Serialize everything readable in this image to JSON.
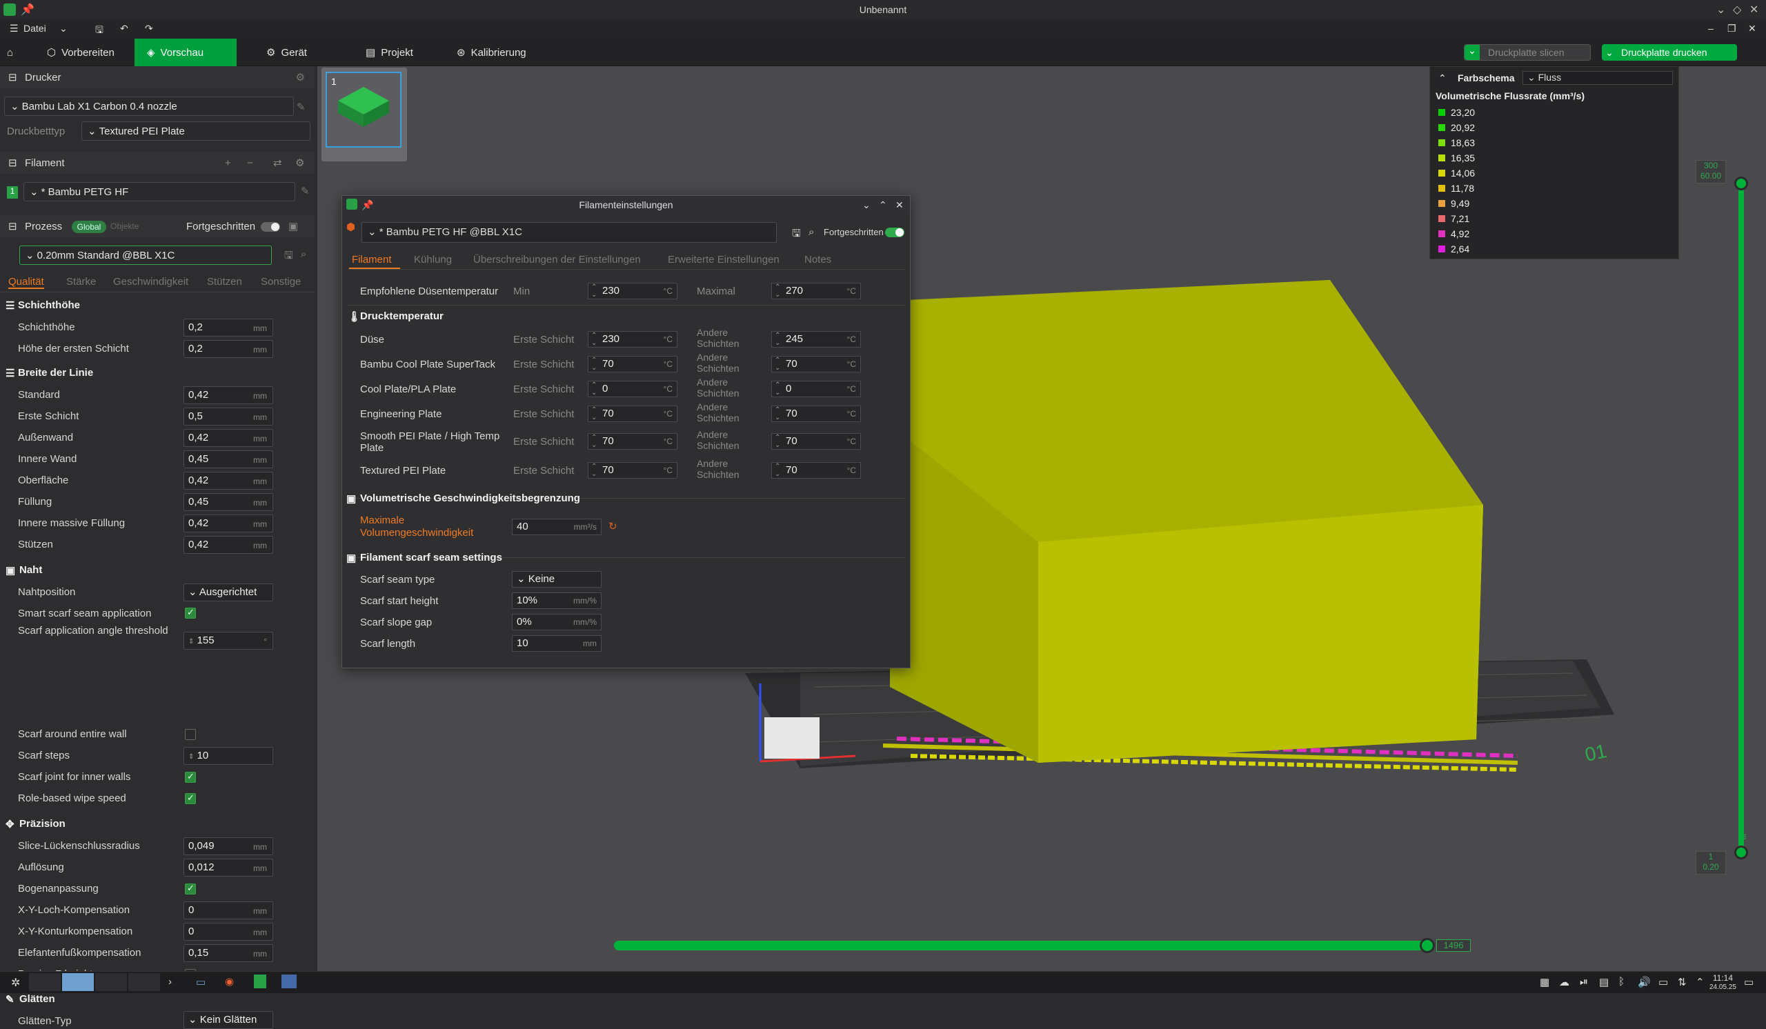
{
  "window": {
    "title": "Unbenannt"
  },
  "menu": {
    "file": "Datei"
  },
  "toolbar": {
    "tabs": [
      "Vorbereiten",
      "Vorschau",
      "Gerät",
      "Projekt",
      "Kalibrierung"
    ],
    "slice_plate": "Druckplatte slicen",
    "print_plate": "Druckplatte drucken"
  },
  "printer": {
    "header": "Drucker",
    "model": "Bambu Lab X1 Carbon 0.4 nozzle",
    "bed_label": "Druckbetttyp",
    "bed_value": "Textured PEI Plate"
  },
  "filament": {
    "header": "Filament",
    "index": "1",
    "value": "* Bambu PETG HF"
  },
  "process": {
    "header": "Prozess",
    "global": "Global",
    "objects": "Objekte",
    "advanced": "Fortgeschritten",
    "preset": "0.20mm Standard @BBL X1C",
    "tabs": [
      "Qualität",
      "Stärke",
      "Geschwindigkeit",
      "Stützen",
      "Sonstige"
    ]
  },
  "settings": {
    "layer_height_header": "Schichthöhe",
    "layer_height_label": "Schichthöhe",
    "layer_height_value": "0,2",
    "first_layer_label": "Höhe der ersten Schicht",
    "first_layer_value": "0,2",
    "line_width_header": "Breite der Linie",
    "lw": [
      {
        "label": "Standard",
        "value": "0,42"
      },
      {
        "label": "Erste Schicht",
        "value": "0,5"
      },
      {
        "label": "Außenwand",
        "value": "0,42"
      },
      {
        "label": "Innere Wand",
        "value": "0,45"
      },
      {
        "label": "Oberfläche",
        "value": "0,42"
      },
      {
        "label": "Füllung",
        "value": "0,45"
      },
      {
        "label": "Innere massive Füllung",
        "value": "0,42"
      },
      {
        "label": "Stützen",
        "value": "0,42"
      }
    ],
    "seam_header": "Naht",
    "seam_position_label": "Nahtposition",
    "seam_position_value": "Ausgerichtet",
    "smart_scarf_label": "Smart scarf seam application",
    "scarf_angle_label": "Scarf application angle threshold",
    "scarf_angle_value": "155",
    "scarf_entire_label": "Scarf around entire wall",
    "scarf_steps_label": "Scarf steps",
    "scarf_steps_value": "10",
    "scarf_inner_label": "Scarf joint for inner walls",
    "role_wipe_label": "Role-based wipe speed",
    "precision_header": "Präzision",
    "prec": [
      {
        "label": "Slice-Lückenschlussradius",
        "value": "0,049"
      },
      {
        "label": "Auflösung",
        "value": "0,012"
      }
    ],
    "arc_label": "Bogenanpassung",
    "xy_hole_label": "X-Y-Loch-Kompensation",
    "xy_hole_value": "0",
    "xy_contour_label": "X-Y-Konturkompensation",
    "xy_contour_value": "0",
    "elephant_label": "Elefantenfußkompensation",
    "elephant_value": "0,15",
    "precise_z_label": "Precise Z height",
    "ironing_header": "Glätten",
    "ironing_type_label": "Glätten-Typ",
    "ironing_type_value": "Kein Glätten",
    "unit_mm": "mm"
  },
  "plate": {
    "number": "1"
  },
  "legend": {
    "label": "Farbschema",
    "scheme": "Fluss",
    "title": "Volumetrische Flussrate (mm³/s)",
    "items": [
      {
        "value": "23,20",
        "color": "#00d000"
      },
      {
        "value": "20,92",
        "color": "#2ad800"
      },
      {
        "value": "18,63",
        "color": "#7ee000"
      },
      {
        "value": "16,35",
        "color": "#b8e000"
      },
      {
        "value": "14,06",
        "color": "#d8d800"
      },
      {
        "value": "11,78",
        "color": "#e0c000"
      },
      {
        "value": "9,49",
        "color": "#e8a040"
      },
      {
        "value": "7,21",
        "color": "#e86a70"
      },
      {
        "value": "4,92",
        "color": "#e030c0"
      },
      {
        "value": "2,64",
        "color": "#e020e0"
      }
    ]
  },
  "vslider": {
    "top_a": "300",
    "top_b": "60.00",
    "bottom_a": "1",
    "bottom_b": "0.20"
  },
  "hslider": {
    "value": "1496"
  },
  "dialog": {
    "title": "Filamenteinstellungen",
    "preset": "* Bambu PETG HF @BBL X1C",
    "advanced": "Fortgeschritten",
    "tabs": [
      "Filament",
      "Kühlung",
      "Überschreibungen der Einstellungen",
      "Erweiterte Einstellungen",
      "Notes"
    ],
    "nozzle_temp_label": "Empfohlene Düsentemperatur",
    "min_label": "Min",
    "min_value": "230",
    "max_label": "Maximal",
    "max_value": "270",
    "print_temp_header": "Drucktemperatur",
    "first_layer": "Erste Schicht",
    "other_layers": "Andere Schichten",
    "temps": [
      {
        "label": "Düse",
        "first": "230",
        "other": "245"
      },
      {
        "label": "Bambu Cool Plate SuperTack",
        "first": "70",
        "other": "70"
      },
      {
        "label": "Cool Plate/PLA Plate",
        "first": "0",
        "other": "0"
      },
      {
        "label": "Engineering Plate",
        "first": "70",
        "other": "70"
      },
      {
        "label": "Smooth PEI Plate / High Temp Plate",
        "first": "70",
        "other": "70"
      },
      {
        "label": "Textured PEI Plate",
        "first": "70",
        "other": "70"
      }
    ],
    "unit_c": "°C",
    "vol_header": "Volumetrische Geschwindigkeitsbegrenzung",
    "max_vol_label": "Maximale Volumengeschwindigkeit",
    "max_vol_value": "40",
    "unit_vol": "mm³/s",
    "scarf_header": "Filament scarf seam settings",
    "scarf_type_label": "Scarf seam type",
    "scarf_type_value": "Keine",
    "scarf_start_label": "Scarf start height",
    "scarf_start_value": "10%",
    "unit_mmpct": "mm/%",
    "scarf_gap_label": "Scarf slope gap",
    "scarf_gap_value": "0%",
    "scarf_length_label": "Scarf length",
    "scarf_length_value": "10",
    "unit_mm": "mm"
  },
  "taskbar": {
    "time": "11:14",
    "date": "24.05.25"
  }
}
